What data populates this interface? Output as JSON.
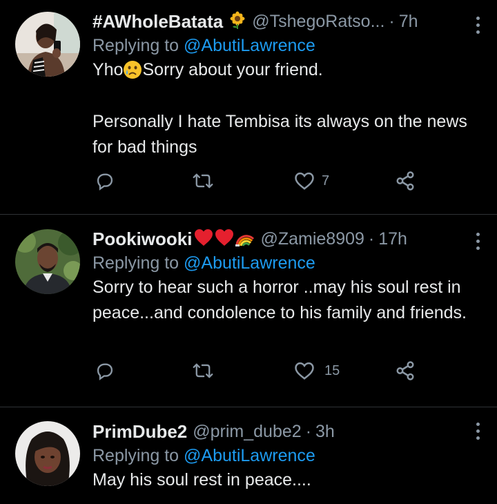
{
  "tweets": [
    {
      "name": "#AWholeBatata",
      "name_emoji": "sunflower",
      "handle": "@TshegoRatso...",
      "sep": "·",
      "time": "7h",
      "replying_prefix": "Replying to",
      "replying_to": "@AbutiLawrence",
      "text_before_emoji": "Yho",
      "text_emoji": "crying-face",
      "text_line1_after": "Sorry about your friend.",
      "text_para2": "Personally I hate Tembisa its always on the news for bad things",
      "likes": "7"
    },
    {
      "name": "Pookiwooki",
      "name_emoji": "hearts-and-rainbow",
      "handle": "@Zamie8909",
      "sep": "·",
      "time": "17h",
      "replying_prefix": "Replying to",
      "replying_to": "@AbutiLawrence",
      "text": "Sorry to hear such a horror ..may his soul rest in peace...and condolence to his family and friends.",
      "likes": "15"
    },
    {
      "name": "PrimDube2",
      "handle": "@prim_dube2",
      "sep": "·",
      "time": "3h",
      "replying_prefix": "Replying to",
      "replying_to": "@AbutiLawrence",
      "text": "May his soul rest in peace...."
    }
  ],
  "colors": {
    "background": "#000000",
    "text": "#e7e9ea",
    "secondary": "#8b98a5",
    "link": "#1d9bf0",
    "divider": "#2f3336"
  },
  "icons": [
    "reply-icon",
    "retweet-icon",
    "like-icon",
    "share-icon",
    "more-icon"
  ]
}
